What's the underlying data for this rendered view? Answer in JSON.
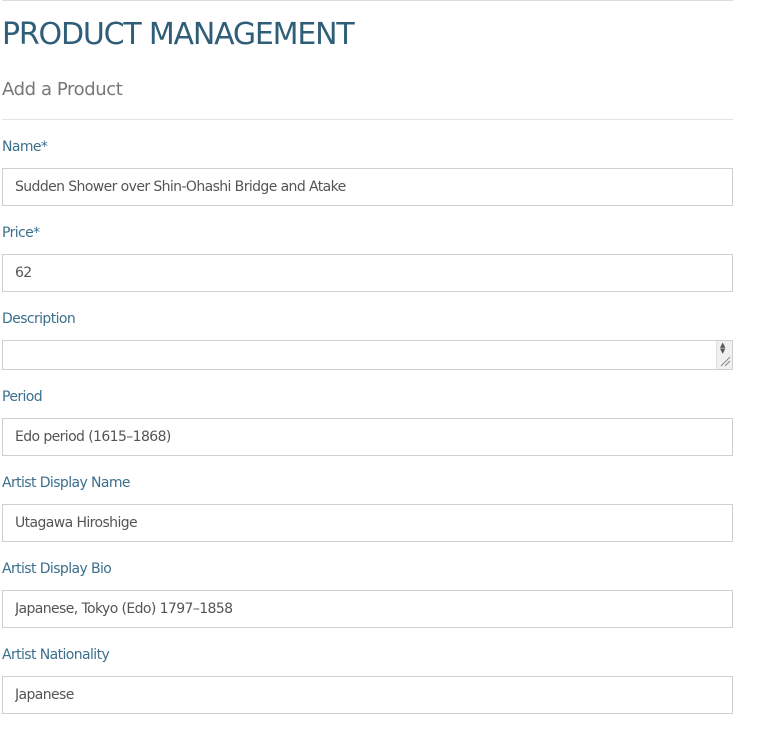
{
  "header": {
    "page_title": "PRODUCT MANAGEMENT",
    "section_title": "Add a Product"
  },
  "form": {
    "name": {
      "label": "Name*",
      "value": "Sudden Shower over Shin-Ōhashi Bridge and Atake"
    },
    "price": {
      "label": "Price*",
      "value": "62"
    },
    "description": {
      "label": "Description",
      "value": ""
    },
    "period": {
      "label": "Period",
      "value": "Edo period (1615–1868)"
    },
    "artist_display_name": {
      "label": "Artist Display Name",
      "value": "Utagawa Hiroshige"
    },
    "artist_display_bio": {
      "label": "Artist Display Bio",
      "value": "Japanese, Tokyo (Edo) 1797–1858"
    },
    "artist_nationality": {
      "label": "Artist Nationality",
      "value": "Japanese"
    }
  },
  "icons": {
    "textarea_scroll": "scroll-arrows-icon",
    "textarea_resize": "resize-grip-icon"
  },
  "colors": {
    "title": "#2f5e78",
    "label": "#3b6f8c",
    "border": "#cfcfcf"
  }
}
